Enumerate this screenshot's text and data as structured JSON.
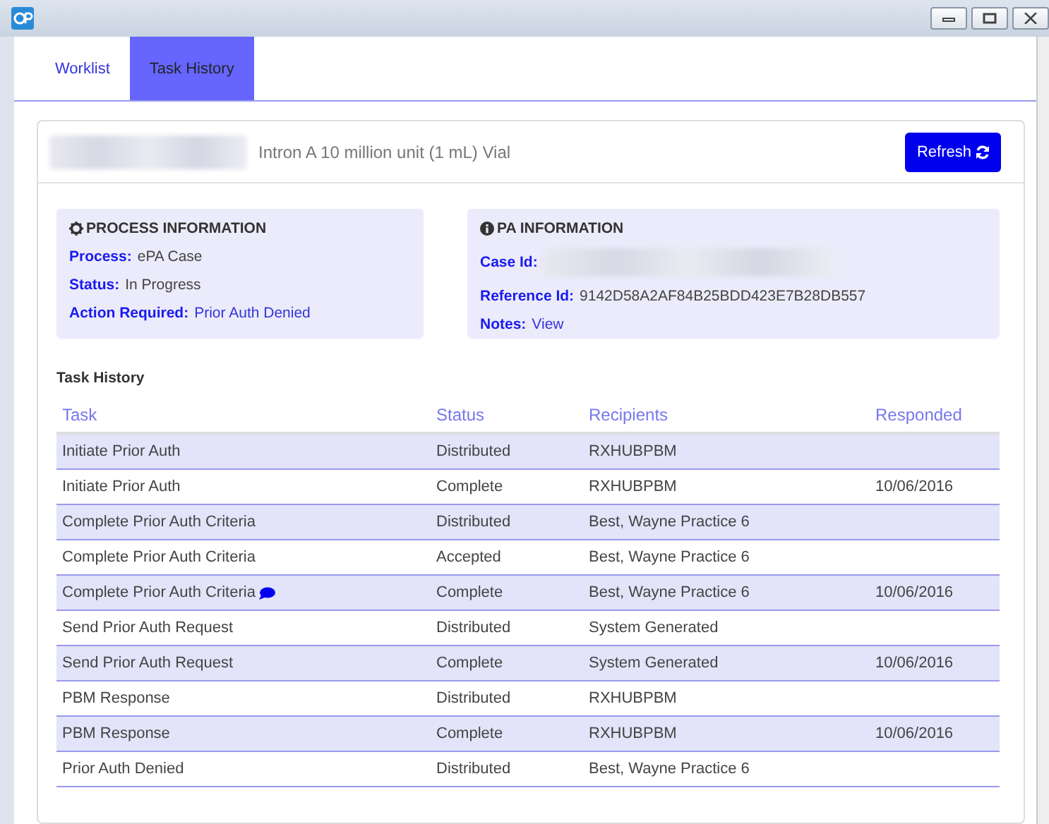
{
  "tabs": [
    {
      "label": "Worklist",
      "selected": false
    },
    {
      "label": "Task History",
      "selected": true
    }
  ],
  "header": {
    "drug": "Intron A 10 million unit (1 mL) Vial",
    "refresh_button": "Refresh"
  },
  "process_information": {
    "title": "PROCESS INFORMATION",
    "fields": [
      {
        "label": "Process:",
        "value": "ePA Case",
        "kind": "text"
      },
      {
        "label": "Status:",
        "value": "In Progress",
        "kind": "text"
      },
      {
        "label": "Action Required:",
        "value": "Prior Auth Denied",
        "kind": "link"
      }
    ]
  },
  "pa_information": {
    "title": "PA INFORMATION",
    "fields": [
      {
        "label": "Case Id:",
        "kind": "redacted"
      },
      {
        "label": "Reference Id:",
        "value": "9142D58A2AF84B25BDD423E7B28DB557",
        "kind": "text"
      },
      {
        "label": "Notes:",
        "value": "View",
        "kind": "link"
      }
    ]
  },
  "task_history": {
    "title": "Task History",
    "columns": [
      "Task",
      "Status",
      "Recipients",
      "Responded"
    ],
    "rows": [
      {
        "task": "Initiate Prior Auth",
        "status": "Distributed",
        "recipients": "RXHUBPBM",
        "comment": false
      },
      {
        "task": "Initiate Prior Auth",
        "status": "Complete",
        "recipients": "RXHUBPBM",
        "responded": "10/06/2016",
        "comment": false
      },
      {
        "task": "Complete Prior Auth Criteria",
        "status": "Distributed",
        "recipients": "Best, Wayne Practice 6",
        "comment": false
      },
      {
        "task": "Complete Prior Auth Criteria",
        "status": "Accepted",
        "recipients": "Best, Wayne Practice 6",
        "comment": false
      },
      {
        "task": "Complete Prior Auth Criteria",
        "status": "Complete",
        "recipients": "Best, Wayne Practice 6",
        "responded": "10/06/2016",
        "comment": true
      },
      {
        "task": "Send Prior Auth Request",
        "status": "Distributed",
        "recipients": "System Generated",
        "comment": false
      },
      {
        "task": "Send Prior Auth Request",
        "status": "Complete",
        "recipients": "System Generated",
        "responded": "10/06/2016",
        "comment": false
      },
      {
        "task": "PBM Response",
        "status": "Distributed",
        "recipients": "RXHUBPBM",
        "comment": false
      },
      {
        "task": "PBM Response",
        "status": "Complete",
        "recipients": "RXHUBPBM",
        "responded": "10/06/2016",
        "comment": false
      },
      {
        "task": "Prior Auth Denied",
        "status": "Distributed",
        "recipients": "Best, Wayne Practice 6",
        "comment": false
      }
    ]
  }
}
